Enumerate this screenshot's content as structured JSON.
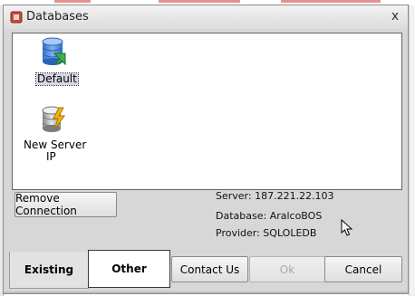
{
  "window": {
    "title": "Databases",
    "close_glyph": "x"
  },
  "databases": [
    {
      "label": "Default",
      "icon": "database-default-icon",
      "selected": true
    },
    {
      "label_line1": "New Server",
      "label_line2": "IP",
      "icon": "new-server-database-icon",
      "selected": false
    }
  ],
  "actions": {
    "remove_connection": "Remove Connection"
  },
  "connection_info": {
    "server": "Server: 187.221.22.103",
    "database": "Database: AralcoBOS",
    "provider": "Provider: SQLOLEDB"
  },
  "tabs": [
    {
      "label": "Existing",
      "active": true
    },
    {
      "label": "Other",
      "active": false
    }
  ],
  "footer": {
    "contact_us": "Contact Us",
    "ok": "Ok",
    "cancel": "Cancel"
  },
  "colors": {
    "dialog_background": "#d7d7d7",
    "selection_background": "#d6d6e8",
    "database_icon_blue": "#4a86d6",
    "lightning_yellow": "#f2b600"
  }
}
